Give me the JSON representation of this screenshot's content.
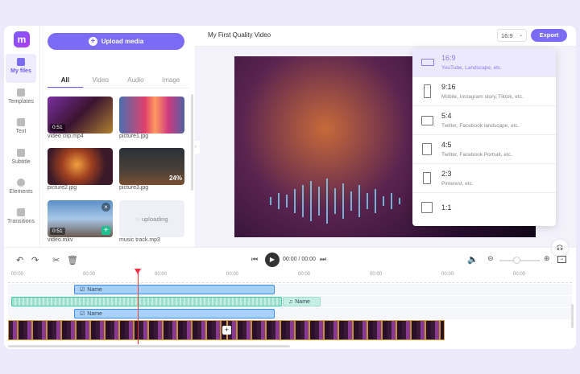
{
  "sidebar": {
    "items": [
      {
        "label": "My files",
        "icon": "folder-plus-icon"
      },
      {
        "label": "Templates",
        "icon": "templates-icon"
      },
      {
        "label": "Text",
        "icon": "text-icon"
      },
      {
        "label": "Subtitle",
        "icon": "subtitle-icon"
      },
      {
        "label": "Elements",
        "icon": "elements-icon"
      },
      {
        "label": "Transitions",
        "icon": "transitions-icon"
      }
    ]
  },
  "media": {
    "upload_label": "Upload media",
    "tabs": [
      "All",
      "Video",
      "Audio",
      "Image"
    ],
    "files": [
      {
        "name": "video clip.mp4",
        "duration": "0:51"
      },
      {
        "name": "picture1.jpg"
      },
      {
        "name": "picture2.jpg"
      },
      {
        "name": "picture3.jpg",
        "progress": "24%"
      },
      {
        "name": "video.mkv",
        "duration": "0:51"
      },
      {
        "name": "music track.mp3",
        "status": "uploading"
      }
    ]
  },
  "header": {
    "title": "My First Quality Video",
    "ratio": "16:9",
    "export_label": "Export"
  },
  "ratios": [
    {
      "ratio": "16:9",
      "desc": "YouTube, Landscape, etc."
    },
    {
      "ratio": "9:16",
      "desc": "Mobile, Instagram story, Tiktok, etc."
    },
    {
      "ratio": "5:4",
      "desc": "Twitter, Facebook landscape, etc."
    },
    {
      "ratio": "4:5",
      "desc": "Twitter, Facebook Portrait, etc."
    },
    {
      "ratio": "2:3",
      "desc": "Pinterest, etc."
    },
    {
      "ratio": "1:1",
      "desc": ""
    }
  ],
  "timeline": {
    "time": "00:00 / 00:00",
    "ticks": [
      "00:00",
      "00:00",
      "00:00",
      "00:00",
      "00:00",
      "00:00",
      "00:00",
      "00:00"
    ],
    "clip1": "Name",
    "audio": "Name",
    "clip2": "Name",
    "zoom": 0.4
  }
}
